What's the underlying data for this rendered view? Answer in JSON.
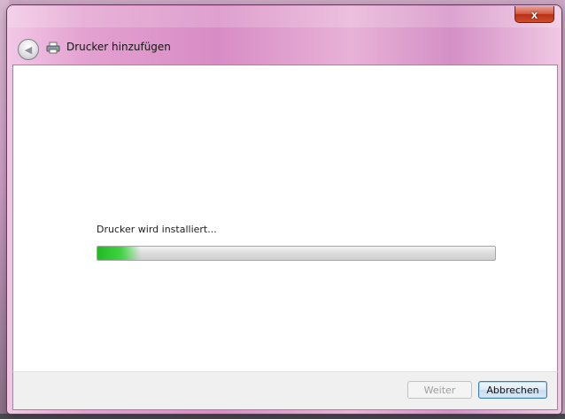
{
  "window": {
    "title": "Drucker hinzufügen",
    "close_label": "x",
    "back_icon": "back-arrow-icon",
    "title_icon": "printer-icon"
  },
  "content": {
    "status_text": "Drucker wird installiert...",
    "progress_fraction": 0.11
  },
  "buttons": {
    "next_label": "Weiter",
    "next_enabled": false,
    "cancel_label": "Abbrechen"
  },
  "colors": {
    "progress_green": "#2fc833",
    "frame_accent": "#d88cc5",
    "default_button_border": "#3c7fb1"
  }
}
